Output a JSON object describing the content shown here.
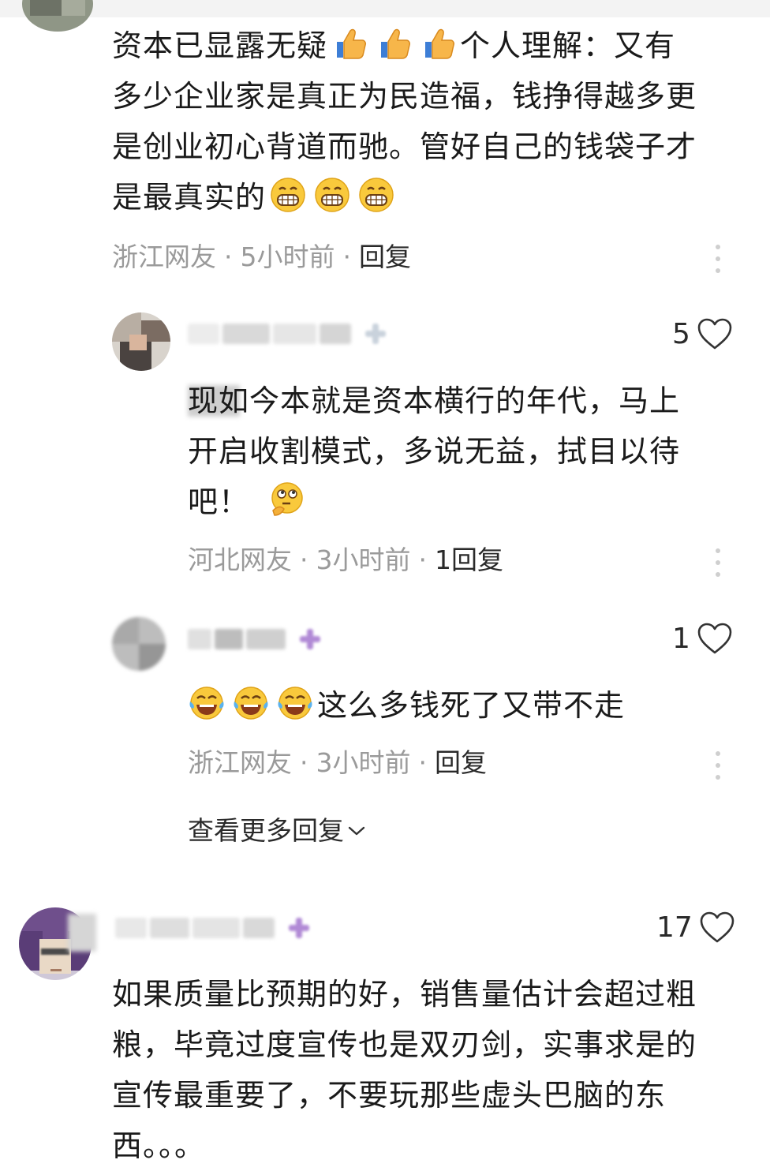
{
  "comments": [
    {
      "text_before": "资本已显露无疑",
      "text_after": "个人理解：又有多少企业家是真正为民造福，钱挣得越多更是创业初心背道而驰。管好自己的钱袋子才是最真实的",
      "emoji_mid": "thumbs-up x3",
      "emoji_end": "grin x3",
      "location": "浙江网友",
      "time": "5小时前",
      "reply_label": "回复"
    },
    {
      "likes": "5",
      "text": "现如今本就是资本横行的年代，马上开启收割模式，多说无益，拭目以待吧！",
      "emoji_end": "thinking-face",
      "location": "河北网友",
      "time": "3小时前",
      "reply_label": "1回复"
    },
    {
      "likes": "1",
      "emoji_start": "laughing-tears x3",
      "text": "这么多钱死了又带不走",
      "location": "浙江网友",
      "time": "3小时前",
      "reply_label": "回复"
    },
    {
      "likes": "17",
      "text": "如果质量比预期的好，销售量估计会超过粗粮，毕竟过度宣传也是双刃剑，实事求是的宣传最重要了，不要玩那些虚头巴脑的东西。。。"
    }
  ],
  "view_more_replies": "查看更多回复",
  "separator": "·",
  "colors": {
    "meta_gray": "#9a9a9a",
    "text": "#1a1a1a",
    "badge_purple": "#b18ad6"
  }
}
